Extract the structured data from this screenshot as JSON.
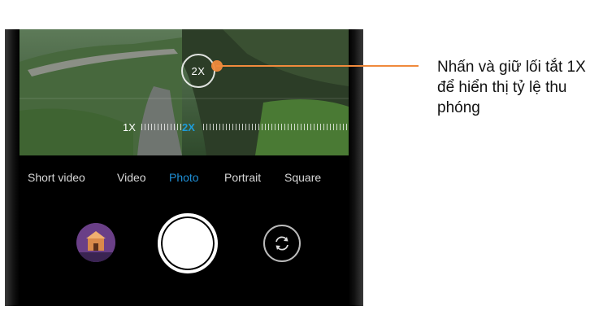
{
  "viewfinder": {
    "zoom_circle_label": "2X",
    "ruler_left_label": "1X",
    "ruler_active_label": "2X"
  },
  "camera_modes": [
    {
      "label": "Short video",
      "active": false
    },
    {
      "label": "Video",
      "active": false
    },
    {
      "label": "Photo",
      "active": true
    },
    {
      "label": "Portrait",
      "active": false
    },
    {
      "label": "Square",
      "active": false
    }
  ],
  "controls": {
    "gallery_icon": "gallery-thumbnail",
    "shutter_icon": "shutter-button",
    "switch_icon": "camera-switch-icon"
  },
  "annotation": {
    "text": "Nhấn và giữ lối tắt 1X để hiển thị tỷ lệ thu phóng"
  },
  "colors": {
    "active_mode": "#1e8fd6",
    "callout": "#f08a3c"
  }
}
